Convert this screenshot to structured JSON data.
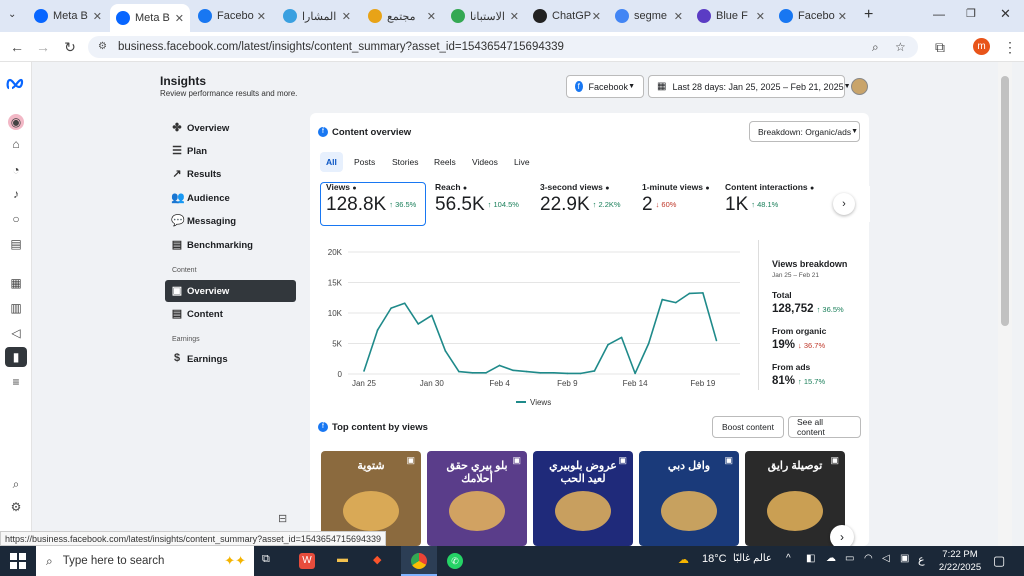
{
  "browser": {
    "tabs": [
      {
        "label": "Meta B",
        "color": "#0866ff"
      },
      {
        "label": "Meta B",
        "color": "#0866ff",
        "active": true
      },
      {
        "label": "Facebo",
        "color": "#1877f2"
      },
      {
        "label": "المشارا",
        "color": "#3aa0e0"
      },
      {
        "label": "مجتمع",
        "color": "#e8a317"
      },
      {
        "label": "الاستبانا",
        "color": "#34a853"
      },
      {
        "label": "ChatGP",
        "color": "#222222"
      },
      {
        "label": "segme",
        "color": "#4285f4"
      },
      {
        "label": "Blue F",
        "color": "#5b3cc4"
      },
      {
        "label": "Facebo",
        "color": "#1877f2"
      }
    ],
    "url": "business.facebook.com/latest/insights/content_summary?asset_id=1543654715694339",
    "status_url": "https://business.facebook.com/latest/insights/content_summary?asset_id=1543654715694339",
    "profile_initial": "m"
  },
  "header": {
    "title": "Insights",
    "subtitle": "Review performance results and more.",
    "platform": "Facebook",
    "date_range": "Last 28 days: Jan 25, 2025 – Feb 21, 2025"
  },
  "menu": {
    "items": [
      {
        "label": "Overview",
        "icon": "✤"
      },
      {
        "label": "Plan",
        "icon": "☰"
      },
      {
        "label": "Results",
        "icon": "↗"
      },
      {
        "label": "Audience",
        "icon": "👥"
      },
      {
        "label": "Messaging",
        "icon": "💬"
      },
      {
        "label": "Benchmarking",
        "icon": "▤"
      }
    ],
    "content_label": "Content",
    "content_items": [
      {
        "label": "Overview",
        "icon": "▣"
      },
      {
        "label": "Content",
        "icon": "▤"
      }
    ],
    "earnings_label": "Earnings",
    "earnings_items": [
      {
        "label": "Earnings",
        "icon": "$"
      }
    ]
  },
  "content_overview": {
    "title": "Content overview",
    "breakdown": "Breakdown: Organic/ads",
    "tabs": [
      "All",
      "Posts",
      "Stories",
      "Reels",
      "Videos",
      "Live"
    ],
    "metrics": [
      {
        "label": "Views",
        "value": "128.8K",
        "delta": "↑ 36.5%",
        "dir": "up"
      },
      {
        "label": "Reach",
        "value": "56.5K",
        "delta": "↑ 104.5%",
        "dir": "up"
      },
      {
        "label": "3-second views",
        "value": "22.9K",
        "delta": "↑ 2.2K%",
        "dir": "up"
      },
      {
        "label": "1-minute views",
        "value": "2",
        "delta": "↓ 60%",
        "dir": "down"
      },
      {
        "label": "Content interactions",
        "value": "1K",
        "delta": "↑ 48.1%",
        "dir": "up"
      }
    ],
    "legend": "Views"
  },
  "chart_data": {
    "type": "line",
    "x": [
      "Jan 25",
      "Jan 26",
      "Jan 27",
      "Jan 28",
      "Jan 29",
      "Jan 30",
      "Jan 31",
      "Feb 1",
      "Feb 2",
      "Feb 3",
      "Feb 4",
      "Feb 5",
      "Feb 6",
      "Feb 7",
      "Feb 8",
      "Feb 9",
      "Feb 10",
      "Feb 11",
      "Feb 12",
      "Feb 13",
      "Feb 14",
      "Feb 15",
      "Feb 16",
      "Feb 17",
      "Feb 18",
      "Feb 19",
      "Feb 20",
      "Feb 21"
    ],
    "x_tick_labels": [
      "Jan 25",
      "Jan 30",
      "Feb 4",
      "Feb 9",
      "Feb 14",
      "Feb 19"
    ],
    "series": [
      {
        "name": "Views",
        "values": [
          500,
          7200,
          10800,
          11600,
          8200,
          9600,
          3800,
          400,
          200,
          200,
          1400,
          600,
          400,
          200,
          200,
          100,
          100,
          500,
          4800,
          6000,
          100,
          5000,
          12200,
          11700,
          13200,
          13300,
          5500
        ]
      }
    ],
    "yticks": [
      0,
      5000,
      10000,
      15000,
      20000
    ],
    "ytick_labels": [
      "0",
      "5K",
      "10K",
      "15K",
      "20K"
    ],
    "ylim": [
      0,
      20000
    ],
    "color": "#1f8a8a"
  },
  "views_breakdown": {
    "title": "Views breakdown",
    "range": "Jan 25 – Feb 21",
    "total_label": "Total",
    "total": "128,752",
    "total_delta": "↑ 36.5%",
    "organic_label": "From organic",
    "organic": "19%",
    "organic_delta": "↓ 36.7%",
    "ads_label": "From ads",
    "ads": "81%",
    "ads_delta": "↑ 15.7%"
  },
  "top_content": {
    "title": "Top content by views",
    "boost": "Boost content",
    "see_all": "See all content",
    "thumbs": [
      {
        "caption": "شتوية",
        "bg": "#8b6a3e"
      },
      {
        "caption": "بلو بيري حقق أحلامك",
        "bg": "#5a3d8a"
      },
      {
        "caption": "عروض بلوبيري لعيد الحب",
        "bg": "#1f2a7a"
      },
      {
        "caption": "وافل دبي",
        "bg": "#1a3a7a"
      },
      {
        "caption": "توصيلة رايق",
        "bg": "#2a2a2a"
      }
    ]
  },
  "taskbar": {
    "search": "Type here to search",
    "weather": "18°C",
    "weather_text": "عالم غالبًا",
    "lang": "ع",
    "time": "7:22 PM",
    "date": "2/22/2025"
  }
}
